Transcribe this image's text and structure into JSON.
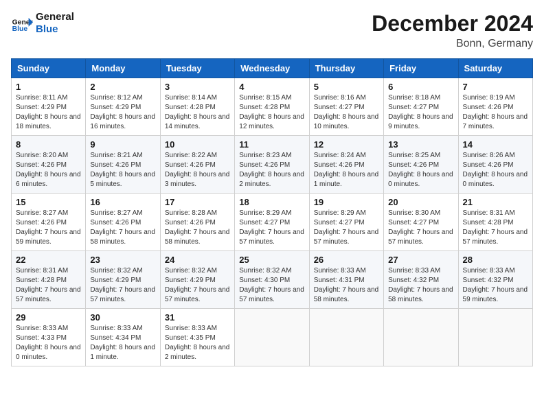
{
  "header": {
    "logo_general": "General",
    "logo_blue": "Blue",
    "month_title": "December 2024",
    "location": "Bonn, Germany"
  },
  "days_of_week": [
    "Sunday",
    "Monday",
    "Tuesday",
    "Wednesday",
    "Thursday",
    "Friday",
    "Saturday"
  ],
  "weeks": [
    [
      {
        "day": "1",
        "sunrise": "8:11 AM",
        "sunset": "4:29 PM",
        "daylight": "8 hours and 18 minutes."
      },
      {
        "day": "2",
        "sunrise": "8:12 AM",
        "sunset": "4:29 PM",
        "daylight": "8 hours and 16 minutes."
      },
      {
        "day": "3",
        "sunrise": "8:14 AM",
        "sunset": "4:28 PM",
        "daylight": "8 hours and 14 minutes."
      },
      {
        "day": "4",
        "sunrise": "8:15 AM",
        "sunset": "4:28 PM",
        "daylight": "8 hours and 12 minutes."
      },
      {
        "day": "5",
        "sunrise": "8:16 AM",
        "sunset": "4:27 PM",
        "daylight": "8 hours and 10 minutes."
      },
      {
        "day": "6",
        "sunrise": "8:18 AM",
        "sunset": "4:27 PM",
        "daylight": "8 hours and 9 minutes."
      },
      {
        "day": "7",
        "sunrise": "8:19 AM",
        "sunset": "4:26 PM",
        "daylight": "8 hours and 7 minutes."
      }
    ],
    [
      {
        "day": "8",
        "sunrise": "8:20 AM",
        "sunset": "4:26 PM",
        "daylight": "8 hours and 6 minutes."
      },
      {
        "day": "9",
        "sunrise": "8:21 AM",
        "sunset": "4:26 PM",
        "daylight": "8 hours and 5 minutes."
      },
      {
        "day": "10",
        "sunrise": "8:22 AM",
        "sunset": "4:26 PM",
        "daylight": "8 hours and 3 minutes."
      },
      {
        "day": "11",
        "sunrise": "8:23 AM",
        "sunset": "4:26 PM",
        "daylight": "8 hours and 2 minutes."
      },
      {
        "day": "12",
        "sunrise": "8:24 AM",
        "sunset": "4:26 PM",
        "daylight": "8 hours and 1 minute."
      },
      {
        "day": "13",
        "sunrise": "8:25 AM",
        "sunset": "4:26 PM",
        "daylight": "8 hours and 0 minutes."
      },
      {
        "day": "14",
        "sunrise": "8:26 AM",
        "sunset": "4:26 PM",
        "daylight": "8 hours and 0 minutes."
      }
    ],
    [
      {
        "day": "15",
        "sunrise": "8:27 AM",
        "sunset": "4:26 PM",
        "daylight": "7 hours and 59 minutes."
      },
      {
        "day": "16",
        "sunrise": "8:27 AM",
        "sunset": "4:26 PM",
        "daylight": "7 hours and 58 minutes."
      },
      {
        "day": "17",
        "sunrise": "8:28 AM",
        "sunset": "4:26 PM",
        "daylight": "7 hours and 58 minutes."
      },
      {
        "day": "18",
        "sunrise": "8:29 AM",
        "sunset": "4:27 PM",
        "daylight": "7 hours and 57 minutes."
      },
      {
        "day": "19",
        "sunrise": "8:29 AM",
        "sunset": "4:27 PM",
        "daylight": "7 hours and 57 minutes."
      },
      {
        "day": "20",
        "sunrise": "8:30 AM",
        "sunset": "4:27 PM",
        "daylight": "7 hours and 57 minutes."
      },
      {
        "day": "21",
        "sunrise": "8:31 AM",
        "sunset": "4:28 PM",
        "daylight": "7 hours and 57 minutes."
      }
    ],
    [
      {
        "day": "22",
        "sunrise": "8:31 AM",
        "sunset": "4:28 PM",
        "daylight": "7 hours and 57 minutes."
      },
      {
        "day": "23",
        "sunrise": "8:32 AM",
        "sunset": "4:29 PM",
        "daylight": "7 hours and 57 minutes."
      },
      {
        "day": "24",
        "sunrise": "8:32 AM",
        "sunset": "4:29 PM",
        "daylight": "7 hours and 57 minutes."
      },
      {
        "day": "25",
        "sunrise": "8:32 AM",
        "sunset": "4:30 PM",
        "daylight": "7 hours and 57 minutes."
      },
      {
        "day": "26",
        "sunrise": "8:33 AM",
        "sunset": "4:31 PM",
        "daylight": "7 hours and 58 minutes."
      },
      {
        "day": "27",
        "sunrise": "8:33 AM",
        "sunset": "4:32 PM",
        "daylight": "7 hours and 58 minutes."
      },
      {
        "day": "28",
        "sunrise": "8:33 AM",
        "sunset": "4:32 PM",
        "daylight": "7 hours and 59 minutes."
      }
    ],
    [
      {
        "day": "29",
        "sunrise": "8:33 AM",
        "sunset": "4:33 PM",
        "daylight": "8 hours and 0 minutes."
      },
      {
        "day": "30",
        "sunrise": "8:33 AM",
        "sunset": "4:34 PM",
        "daylight": "8 hours and 1 minute."
      },
      {
        "day": "31",
        "sunrise": "8:33 AM",
        "sunset": "4:35 PM",
        "daylight": "8 hours and 2 minutes."
      },
      null,
      null,
      null,
      null
    ]
  ],
  "labels": {
    "sunrise": "Sunrise:",
    "sunset": "Sunset:",
    "daylight": "Daylight:"
  }
}
